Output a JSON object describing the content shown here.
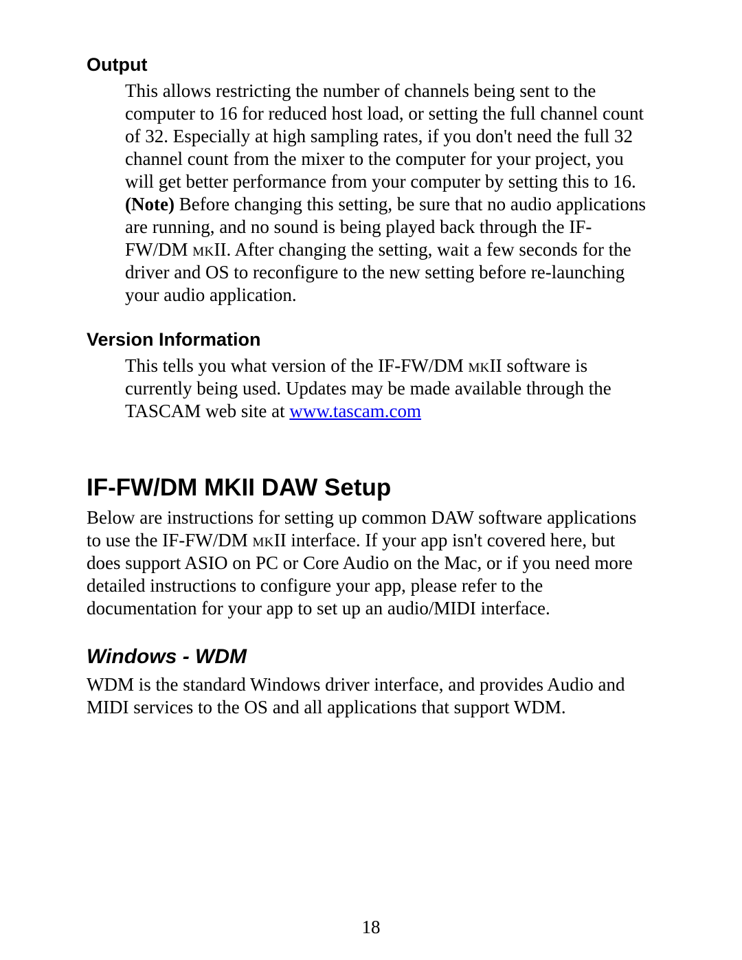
{
  "sections": {
    "output": {
      "heading": "Output",
      "para1": "This allows restricting the number of channels being sent to the computer to 16 for reduced host load, or setting the full channel count of 32. Especially at high sampling rates, if you don't need the full 32 channel count from the mixer to the computer for your project, you will get better performance from your computer by setting this to 16.",
      "note_label": "(Note)",
      "note_text": " Before changing this setting, be sure that no audio applications are running, and no sound is being played back through the IF-FW/DM ",
      "note_sc": "mk",
      "note_text2": "II. After changing the setting, wait a few seconds for the driver and OS to reconfigure to the new setting before re-launching your audio application."
    },
    "version": {
      "heading": "Version Information",
      "para_a": "This tells you what version of the IF-FW/DM ",
      "para_sc": "mk",
      "para_b": "II software is currently being used. Updates may be made available through the TASCAM web site at ",
      "link_text": "www.tascam.com",
      "link_href": "http://www.tascam.com"
    },
    "daw": {
      "heading_a": "IF-FW/DM ",
      "heading_sc": "MK",
      "heading_b": "II DAW Setup",
      "para_a": "Below are instructions for setting up common DAW software applications to use the IF-FW/DM ",
      "para_sc": "mk",
      "para_b": "II interface.  If your app isn't covered here, but does support ASIO on PC or Core Audio on the Mac, or if you need more detailed instructions to configure your app, please refer to the documentation for your app to set up an audio/MIDI interface."
    },
    "wdm": {
      "heading": "Windows - WDM",
      "para": "WDM is the standard Windows driver interface, and provides Audio and MIDI services to the OS and all applications that support WDM."
    }
  },
  "page_number": "18"
}
